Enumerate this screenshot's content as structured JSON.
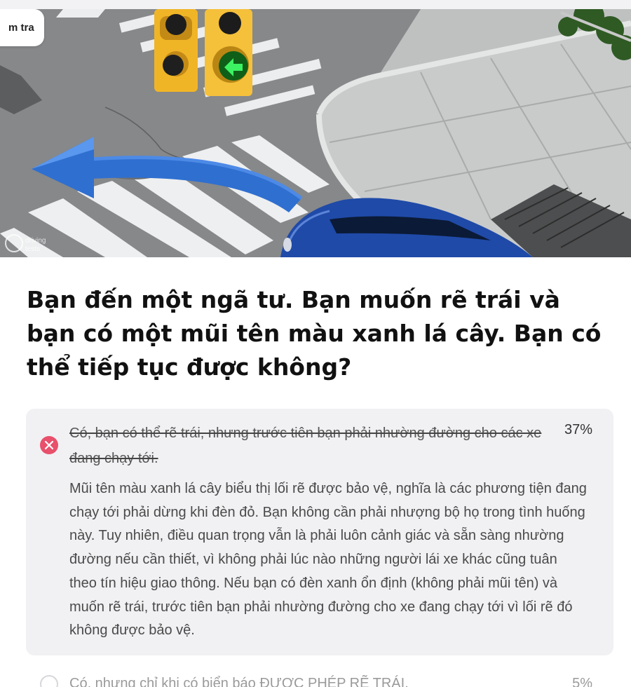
{
  "header": {
    "tag_label": "m tra"
  },
  "scene": {
    "watermark": "driving tests",
    "icons": [
      "traffic-light-icon",
      "left-turn-arrow-icon",
      "car-icon"
    ],
    "colors": {
      "arrow": "#2f6fd0",
      "light_housing": "#f0b527",
      "green_signal": "#37e35a",
      "car": "#1f4aa8"
    }
  },
  "question": {
    "text": "Bạn đến một ngã tư. Bạn muốn rẽ trái và bạn có một mũi tên màu xanh lá cây. Bạn có thể tiếp tục được không?"
  },
  "answers": [
    {
      "text": "Có, bạn có thể rẽ trái, nhưng trước tiên bạn phải nhường đường cho các xe đang chạy tới.",
      "percent": "37%",
      "status": "wrong",
      "explanation": "Mũi tên màu xanh lá cây biểu thị lối rẽ được bảo vệ, nghĩa là các phương tiện đang chạy tới phải dừng khi đèn đỏ. Bạn không cần phải nhượng bộ họ trong tình huống này. Tuy nhiên, điều quan trọng vẫn là phải luôn cảnh giác và sẵn sàng nhường đường nếu cần thiết, vì không phải lúc nào những người lái xe khác cũng tuân theo tín hiệu giao thông. Nếu bạn có đèn xanh ổn định (không phải mũi tên) và muốn rẽ trái, trước tiên bạn phải nhường đường cho xe đang chạy tới vì lối rẽ đó không được bảo vệ."
    },
    {
      "text": "Có, nhưng chỉ khi có biển báo ĐƯỢC PHÉP RẼ TRÁI.",
      "percent": "5%",
      "status": "unselected"
    }
  ],
  "colors": {
    "wrong": "#e8506b",
    "card_bg": "#f1f1f4"
  }
}
